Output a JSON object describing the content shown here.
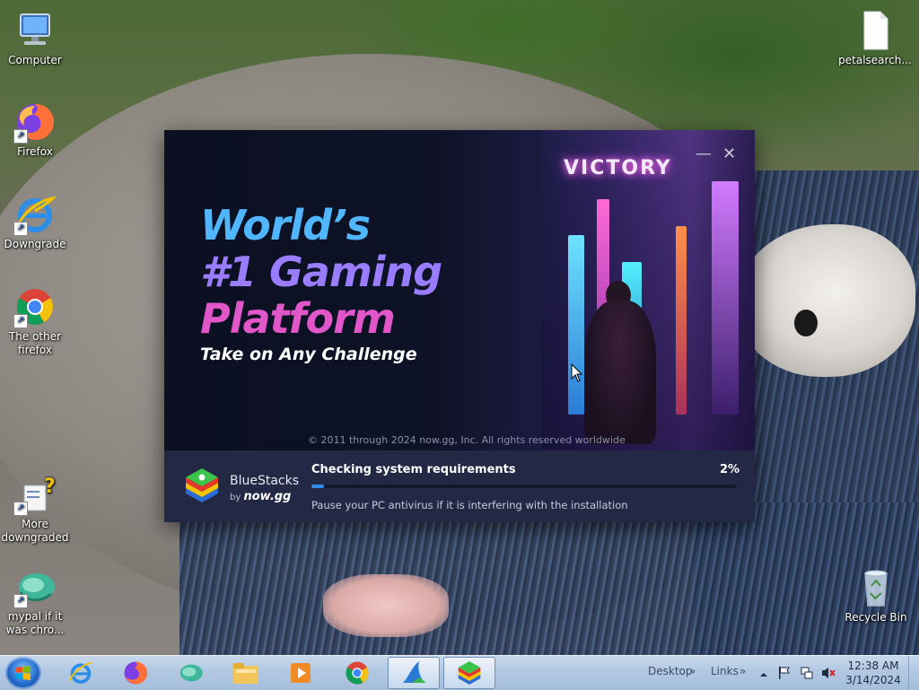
{
  "desktop": {
    "icons": [
      {
        "label": "Computer"
      },
      {
        "label": "Firefox"
      },
      {
        "label": "Downgrade"
      },
      {
        "label": "The other firefox"
      },
      {
        "label": "More downgraded"
      },
      {
        "label": "mypal if it was chro..."
      },
      {
        "label": "petalsearch..."
      },
      {
        "label": "Recycle Bin"
      }
    ]
  },
  "installer": {
    "headline_line1": "World’s",
    "headline_line2": "#1 Gaming",
    "headline_line3": "Platform",
    "tagline": "Take on Any Challenge",
    "copyright": "© 2011 through 2024 now.gg, Inc. All rights reserved worldwide",
    "banner_sign": "VICTORY",
    "minimize_symbol": "—",
    "close_symbol": "✕",
    "brand_name": "BlueStacks",
    "brand_by": "by",
    "brand_partner": "now.gg",
    "status_label": "Checking system requirements",
    "progress_text": "2%",
    "progress_fraction": 0.02,
    "hint": "Pause your PC antivirus if it is interfering with the installation",
    "colors": {
      "progress": "#2f8dea",
      "footer": "#232845",
      "headline_blue": "#4fb6ff",
      "headline_violet": "#9a7dff",
      "headline_pink": "#e157c9"
    }
  },
  "taskbar": {
    "pinned": [
      {
        "icon": "internet-explorer-icon"
      },
      {
        "icon": "firefox-icon"
      },
      {
        "icon": "mypal-icon"
      },
      {
        "icon": "file-explorer-icon"
      },
      {
        "icon": "media-player-icon"
      },
      {
        "icon": "chrome-icon"
      },
      {
        "icon": "installer-shark-icon"
      },
      {
        "icon": "bluestacks-icon"
      }
    ],
    "toolbar_desktop": "Desktop",
    "toolbar_links": "Links",
    "clock_time": "12:38 AM",
    "clock_date": "3/14/2024"
  }
}
